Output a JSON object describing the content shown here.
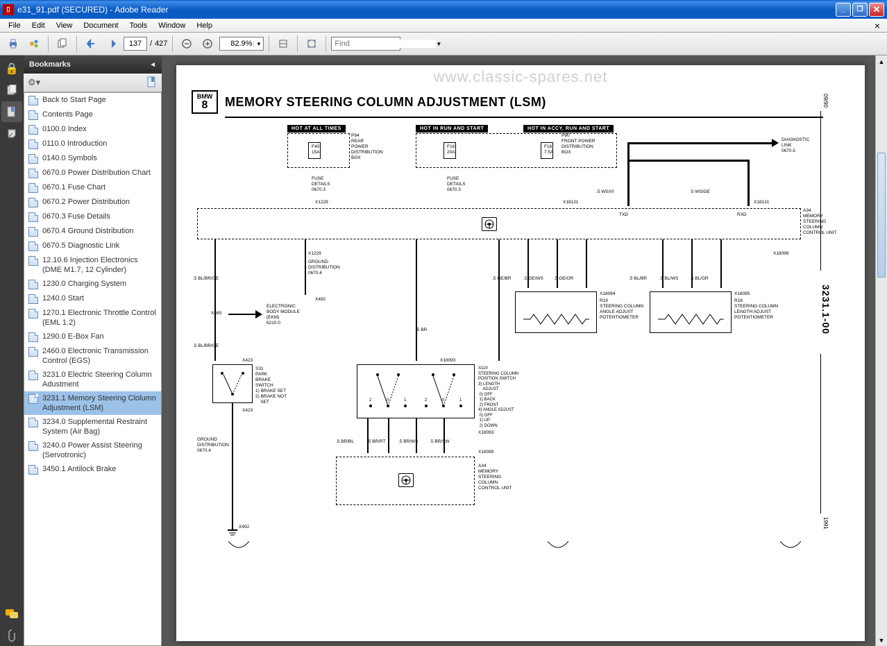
{
  "window": {
    "title": "e31_91.pdf (SECURED) - Adobe Reader"
  },
  "menu": {
    "items": [
      "File",
      "Edit",
      "View",
      "Document",
      "Tools",
      "Window",
      "Help"
    ]
  },
  "toolbar": {
    "page_current": "137",
    "page_sep": "/",
    "page_total": "427",
    "zoom": "82.9%",
    "find_placeholder": "Find"
  },
  "bookmarks_panel": {
    "title": "Bookmarks",
    "items": [
      "Back to Start Page",
      "Contents Page",
      "0100.0 Index",
      "0110.0 Introduction",
      "0140.0 Symbols",
      "0670.0 Power Distribution Chart",
      "0670.1 Fuse Chart",
      "0670.2 Power Distribution",
      "0670.3 Fuse Details",
      "0670.4 Ground Distribution",
      "0670.5 Diagnostic Link",
      "12.10.6 Injection Electronics (DME M1.7, 12 Cylinder)",
      "1230.0 Charging System",
      "1240.0 Start",
      "1270.1 Electronic Throttle Control (EML 1.2)",
      "1290.0 E-Box Fan",
      "2460.0 Electronic Transmission Control (EGS)",
      "3231.0 Electric Steering Column Adustment",
      "3231.1 Memory Steering Clolumn Adjustment (LSM)",
      "3234.0 Supplemental Restraint System (Air Bag)",
      "3240.0 Power Assist Steering (Servotronic)",
      "3450.1 Antilock Brake"
    ],
    "selected_index": 18
  },
  "document": {
    "watermark": "www.classic-spares.net",
    "logo_top": "BMW",
    "logo_bottom": "8",
    "title": "MEMORY STEERING COLUMN ADJUSTMENT (LSM)",
    "side_date": "09/90",
    "side_code": "3231.1-00",
    "side_year": "1991",
    "hot_labels": [
      "HOT AT ALL TIMES",
      "HOT IN RUN AND START",
      "HOT IN ACCY, RUN AND START"
    ],
    "labels": {
      "p94": "P94\nREAR\nPOWER\nDISTRIBUTION\nBOX",
      "f40": "F40\n15A",
      "f16a": "F16\n20A",
      "f16b": "F16\n7.5A",
      "p90": "P90\nFRONT POWER\nDISTRIBUTION\nBOX",
      "diaglink": "DIAGNOSTIC\nLINK\n0670.5",
      "fuse_details": "FUSE\nDETAILS\n0670.3",
      "wsvi": ".5 WS/VI",
      "wsge": ".5 WS/GE",
      "txd": "TXD",
      "rxd": "RXD",
      "a34_top": "A34\nMEMORY\nSTEERING\nCOLUMN\nCONTROL UNIT",
      "a34_bottom": "A34\nMEMORY\nSTEERING\nCOLUMN\nCONTROL UNIT",
      "x1229_top": "X1229",
      "x1229_mid": "X1229",
      "x18131_a": "X18131",
      "x18131_b": "X18131",
      "x18099": "X18099",
      "x18094": "X18094",
      "x18095": "X18095",
      "x18093_a": "X18093",
      "x18093_b": "X18093",
      "x18099_b": "X18099",
      "x465": "X465",
      "x423_a": "X423",
      "x423_b": "X423",
      "x492_a": "X492",
      "x492_b": "X492",
      "ground_dist": "GROUND\nDISTRIBUTION\n0670.4",
      "ground_dist2": "GROUND\nDISTRIBUTION\n0670.4",
      "ekm": "ELECTRONIC\nBODY MODULE\n(EKM)\n6210.0",
      "r19": "R19\nSTEERING COLUMN\nANGLE ADJUST\nPOTENTIOMETER",
      "r18": "R18\nSTEERING COLUMN\nLENGTH ADJUST\nPOTENTIOMETER",
      "s31": "S31\nPARK\nBRAKE\nSWITCH\n1) BRAKE SET\n2) BRAKE NOT\n    SET",
      "s119": "S119\nSTEERING COLUMN\nPOSITION SWITCH\n3) LENGTH\n    ADJUST\n 0) OFF\n 1) BACK\n 2) FRONT\n4) ANGLE ADJUST\n 0) OFF\n 1) UP\n 2) DOWN",
      "wire_blbrge": ".5 BL/BR/GE",
      "wire_blbrge2": ".5 BL/BR/GE",
      "wire_br": ".5 BR",
      "wire_gebr": ".5 GE/BR",
      "wire_gews": ".5 GE/WS",
      "wire_geor": ".5 GE/OR",
      "wire_blbr": ".5 BL/BR",
      "wire_blws": ".5 BL/WS",
      "wire_blgr": ".5 BL/GR",
      "wire_brbl": ".5 BR/BL",
      "wire_brrt": ".5 BR/RT",
      "wire_brws": ".5 BR/WS",
      "wire_brsw": ".5 BR/SW"
    }
  }
}
